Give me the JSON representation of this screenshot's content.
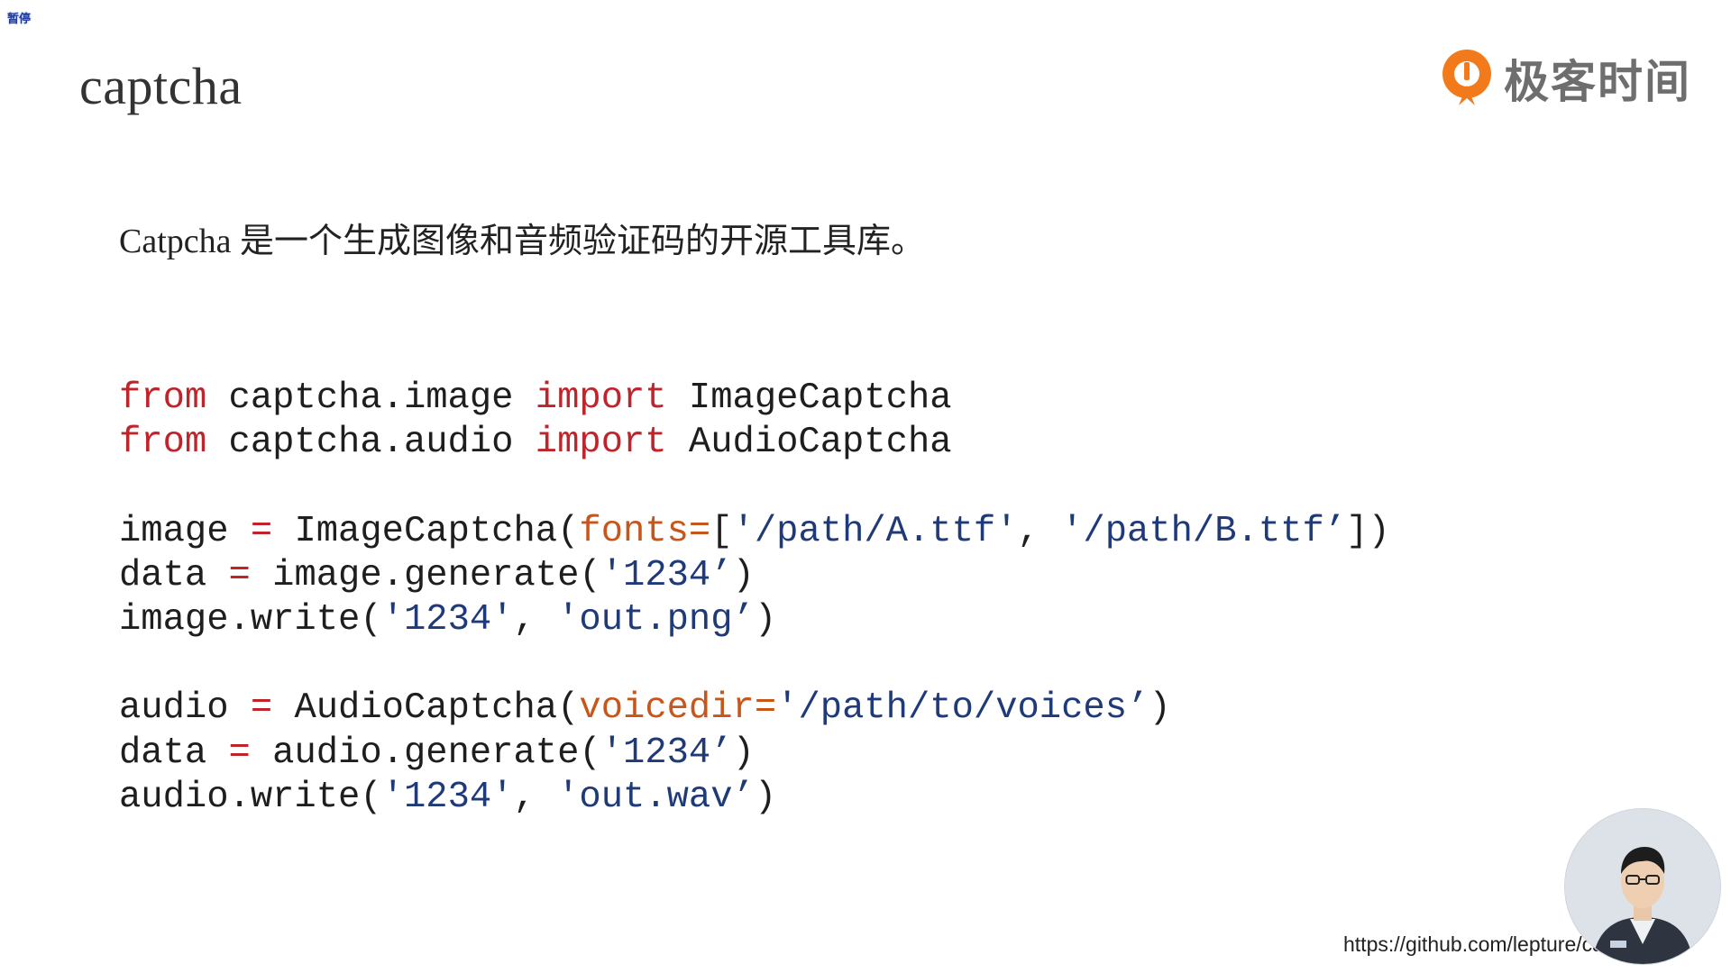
{
  "overlay": {
    "pause_label": "暂停"
  },
  "slide": {
    "title": "captcha",
    "subtitle": "Catpcha 是一个生成图像和音频验证码的开源工具库。",
    "source_url": "https://github.com/lepture/ca"
  },
  "brand": {
    "name": "极客时间",
    "icon": "geektime-logo-icon",
    "accent": "#f27a1a"
  },
  "colors": {
    "keyword": "#c0242b",
    "string": "#1f3a78",
    "argument": "#c8561a",
    "text": "#1e1e1e"
  },
  "code": {
    "lines": [
      [
        {
          "t": "from",
          "k": "kw"
        },
        {
          "t": " captcha.image "
        },
        {
          "t": "import",
          "k": "kw"
        },
        {
          "t": " ImageCaptcha"
        }
      ],
      [
        {
          "t": "from",
          "k": "kw"
        },
        {
          "t": " captcha.audio "
        },
        {
          "t": "import",
          "k": "kw"
        },
        {
          "t": " AudioCaptcha"
        }
      ],
      [],
      [
        {
          "t": "image "
        },
        {
          "t": "=",
          "k": "op"
        },
        {
          "t": " ImageCaptcha("
        },
        {
          "t": "fonts=",
          "k": "arg"
        },
        {
          "t": "["
        },
        {
          "t": "'/path/A.ttf'",
          "k": "str"
        },
        {
          "t": ", "
        },
        {
          "t": "'/path/B.ttf’",
          "k": "str"
        },
        {
          "t": "])"
        }
      ],
      [
        {
          "t": "data "
        },
        {
          "t": "=",
          "k": "op"
        },
        {
          "t": " image.generate("
        },
        {
          "t": "'1234’",
          "k": "str"
        },
        {
          "t": ")"
        }
      ],
      [
        {
          "t": "image.write("
        },
        {
          "t": "'1234'",
          "k": "str"
        },
        {
          "t": ", "
        },
        {
          "t": "'out.png’",
          "k": "str"
        },
        {
          "t": ")"
        }
      ],
      [],
      [
        {
          "t": "audio "
        },
        {
          "t": "=",
          "k": "op"
        },
        {
          "t": " AudioCaptcha("
        },
        {
          "t": "voicedir=",
          "k": "arg"
        },
        {
          "t": "'/path/to/voices’",
          "k": "str"
        },
        {
          "t": ")"
        }
      ],
      [
        {
          "t": "data "
        },
        {
          "t": "=",
          "k": "op"
        },
        {
          "t": " audio.generate("
        },
        {
          "t": "'1234’",
          "k": "str"
        },
        {
          "t": ")"
        }
      ],
      [
        {
          "t": "audio.write("
        },
        {
          "t": "'1234'",
          "k": "str"
        },
        {
          "t": ", "
        },
        {
          "t": "'out.wav’",
          "k": "str"
        },
        {
          "t": ")"
        }
      ]
    ]
  }
}
